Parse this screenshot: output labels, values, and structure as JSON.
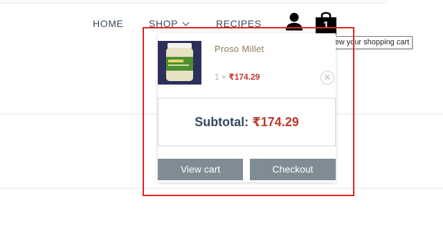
{
  "nav": {
    "home": "HOME",
    "shop": "SHOP",
    "recipes": "RECIPES"
  },
  "header": {
    "cart_count": "1",
    "cart_tooltip": "View your shopping cart",
    "user_icon": "user-icon",
    "cart_icon": "shopping-bag-icon"
  },
  "mini_cart": {
    "items": [
      {
        "name": "Proso Millet",
        "quantity_text": "1 ×",
        "price": "₹174.29",
        "image_label": "millet-jar-image"
      }
    ],
    "remove_icon": "close-circle-icon",
    "subtotal_label": "Subtotal:",
    "subtotal_value": "₹174.29",
    "view_cart_label": "View cart",
    "checkout_label": "Checkout"
  },
  "colors": {
    "price": "#c0392b",
    "button_bg": "#7f8c93",
    "highlight_border": "#e02020",
    "nav_text": "#3a4a5a"
  }
}
